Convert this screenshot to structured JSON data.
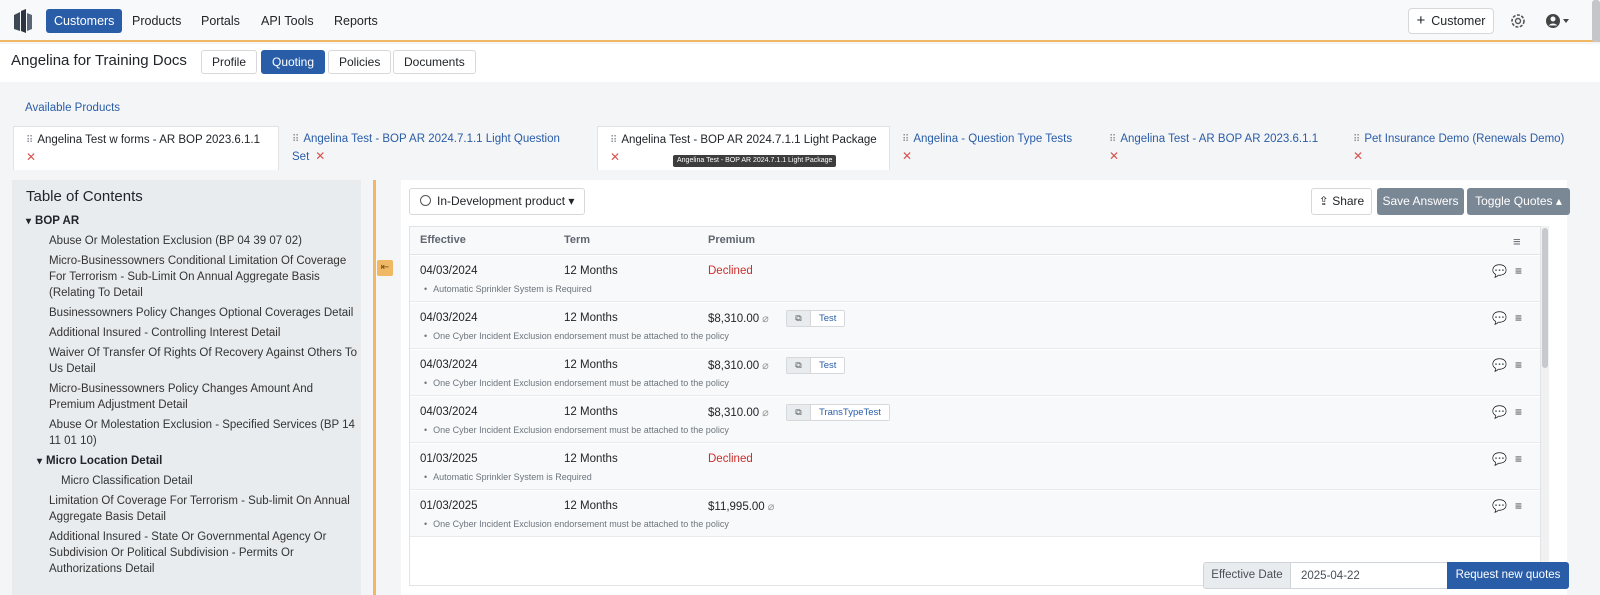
{
  "navbar": {
    "items": [
      "Customers",
      "Products",
      "Portals",
      "API Tools",
      "Reports"
    ],
    "add_customer": "Customer",
    "icons": [
      "logo-icon",
      "gear-icon",
      "user-icon"
    ],
    "accent": "#f0b865",
    "brand": "#2a5da8"
  },
  "header": {
    "title": "Angelina for Training Docs",
    "tabs": [
      "Profile",
      "Quoting",
      "Policies",
      "Documents"
    ]
  },
  "products": {
    "label": "Available Products",
    "tabs": [
      {
        "name": "Angelina Test w forms - AR BOP 2023.6.1.1"
      },
      {
        "name": "Angelina Test - BOP AR 2024.7.1.1 Light Question",
        "name2": "Set"
      },
      {
        "name": "Angelina Test - BOP AR 2024.7.1.1 Light Package"
      },
      {
        "name": "Angelina - Question Type Tests"
      },
      {
        "name": "Angelina Test - AR BOP AR 2023.6.1.1"
      },
      {
        "name": "Pet Insurance Demo (Renewals Demo)"
      }
    ],
    "tooltip": "Angelina Test - BOP AR 2024.7.1.1 Light Package"
  },
  "toc": {
    "title": "Table of Contents",
    "items": [
      "BOP AR",
      "Abuse Or Molestation Exclusion (BP 04 39 07 02)",
      "Micro-Businessowners Conditional Limitation Of Coverage",
      "For Terrorism - Sub-Limit On Annual Aggregate Basis",
      "(Relating To Detail",
      "Businessowners Policy Changes Optional Coverages Detail",
      "Additional Insured - Controlling Interest Detail",
      "Waiver Of Transfer Of Rights Of Recovery Against Others To",
      "Us Detail",
      "Micro-Businessowners Policy Changes Amount And",
      "Premium Adjustment Detail",
      "Abuse Or Molestation Exclusion - Specified Services (BP 14",
      "11 01 10)",
      "Micro Location Detail",
      "Micro Classification Detail",
      "Limitation Of Coverage For Terrorism - Sub-limit On Annual",
      "Aggregate Basis Detail",
      "Additional Insured - State Or Governmental Agency Or",
      "Subdivision Or Political Subdivision - Permits Or",
      "Authorizations Detail"
    ]
  },
  "main": {
    "product_status": "In-Development product",
    "share": "Share",
    "save_answers": "Save Answers",
    "toggle_quotes": "Toggle Quotes",
    "columns": [
      "Effective",
      "Term",
      "Premium"
    ],
    "rows": [
      {
        "effective": "04/03/2024",
        "term": "12 Months",
        "premium": "Declined",
        "note": "Automatic Sprinkler System is Required",
        "tag": ""
      },
      {
        "effective": "04/03/2024",
        "term": "12 Months",
        "premium": "$8,310.00",
        "note": "One Cyber Incident Exclusion endorsement must be attached to the policy",
        "tag": "Test"
      },
      {
        "effective": "04/03/2024",
        "term": "12 Months",
        "premium": "$8,310.00",
        "note": "One Cyber Incident Exclusion endorsement must be attached to the policy",
        "tag": "Test"
      },
      {
        "effective": "04/03/2024",
        "term": "12 Months",
        "premium": "$8,310.00",
        "note": "One Cyber Incident Exclusion endorsement must be attached to the policy",
        "tag": "TransTypeTest"
      },
      {
        "effective": "01/03/2025",
        "term": "12 Months",
        "premium": "Declined",
        "note": "Automatic Sprinkler System is Required",
        "tag": ""
      },
      {
        "effective": "01/03/2025",
        "term": "12 Months",
        "premium": "$11,995.00",
        "note": "One Cyber Incident Exclusion endorsement must be attached to the policy",
        "tag": ""
      }
    ],
    "effective_date_label": "Effective Date",
    "effective_date_value": "2025-04-22",
    "request_button": "Request new quotes"
  }
}
